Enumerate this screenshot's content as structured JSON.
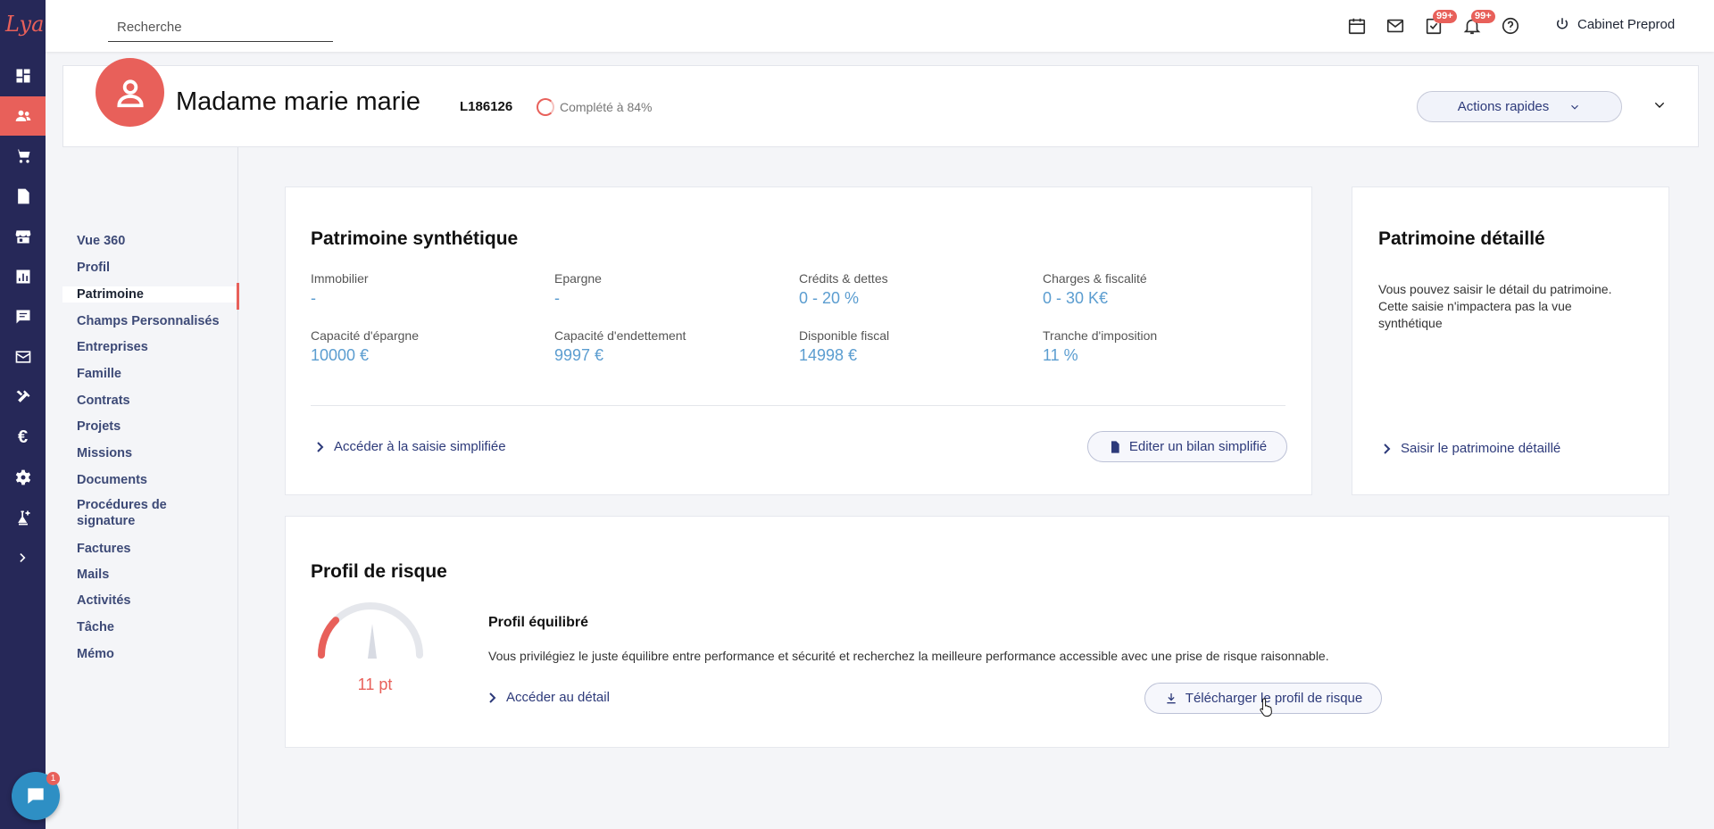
{
  "app": {
    "logo_text": "Lya"
  },
  "topbar": {
    "search_placeholder": "Recherche",
    "tasks_badge": "99+",
    "notifications_badge": "99+",
    "account_label": "Cabinet Preprod"
  },
  "client": {
    "name": "Madame marie marie",
    "id": "L186126",
    "completion": "Complété à 84%",
    "quick_actions": "Actions rapides"
  },
  "subnav": {
    "items": [
      "Vue 360",
      "Profil",
      "Patrimoine",
      "Champs Personnalisés",
      "Entreprises",
      "Famille",
      "Contrats",
      "Projets",
      "Missions",
      "Documents",
      "Procédures de signature",
      "Factures",
      "Mails",
      "Activités",
      "Tâche",
      "Mémo"
    ],
    "active": "Patrimoine"
  },
  "patrimoine_synthetique": {
    "title": "Patrimoine synthétique",
    "fields": [
      {
        "label": "Immobilier",
        "value": "-"
      },
      {
        "label": "Epargne",
        "value": "-"
      },
      {
        "label": "Crédits & dettes",
        "value": "0 - 20 %"
      },
      {
        "label": "Charges & fiscalité",
        "value": "0 - 30 K€"
      },
      {
        "label": "Capacité d'épargne",
        "value": "10000 €"
      },
      {
        "label": "Capacité d'endettement",
        "value": "9997 €"
      },
      {
        "label": "Disponible fiscal",
        "value": "14998 €"
      },
      {
        "label": "Tranche d'imposition",
        "value": "11 %"
      }
    ],
    "link": "Accéder à la saisie simplifiée",
    "button": "Editer un bilan simplifié"
  },
  "patrimoine_detaille": {
    "title": "Patrimoine détaillé",
    "description": "Vous pouvez saisir le détail du patrimoine. Cette saisie n'impactera pas la vue synthétique",
    "link": "Saisir le patrimoine détaillé"
  },
  "profil_risque": {
    "title": "Profil de risque",
    "score": "11 pt",
    "score_fraction": 0.25,
    "profile_name": "Profil équilibré",
    "description": "Vous privilégiez le juste équilibre entre performance et sécurité et recherchez la meilleure performance accessible avec une prise de risque raisonnable.",
    "link": "Accéder au détail",
    "button": "Télécharger le profil de risque"
  },
  "chat": {
    "unread": "1"
  },
  "colors": {
    "accent": "#e8605a",
    "rail": "#262858",
    "value_blue": "#5b9dd0",
    "link_navy": "#2d3a7a"
  }
}
